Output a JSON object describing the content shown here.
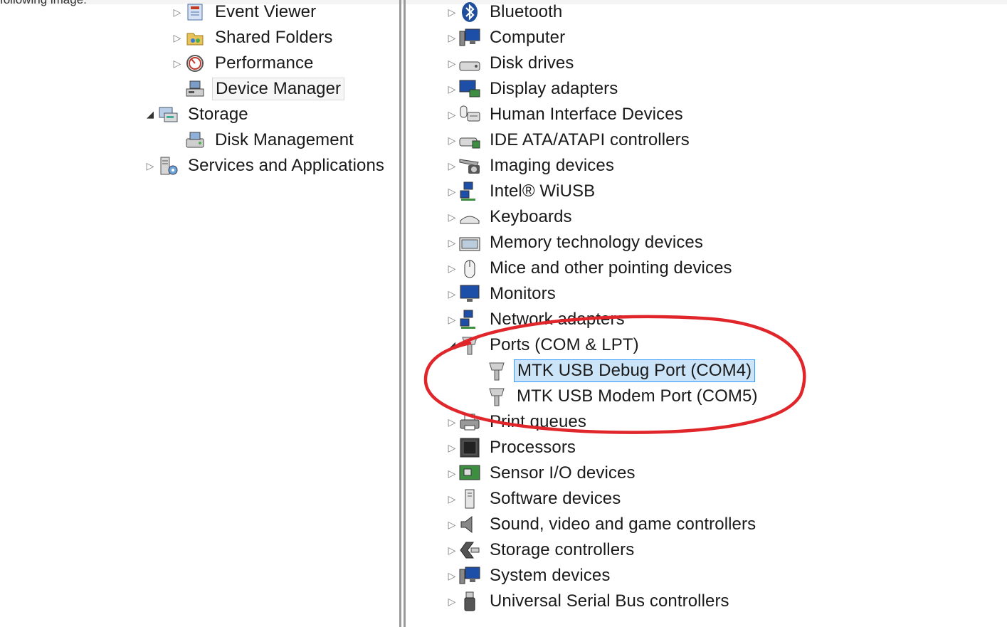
{
  "top_caption": "following image:",
  "left_tree": {
    "items": [
      {
        "label": "Event Viewer",
        "icon": "event-viewer-icon",
        "arrow": "▷"
      },
      {
        "label": "Shared Folders",
        "icon": "shared-folders-icon",
        "arrow": "▷"
      },
      {
        "label": "Performance",
        "icon": "performance-icon",
        "arrow": "▷"
      },
      {
        "label": "Device Manager",
        "icon": "device-manager-icon",
        "arrow": "",
        "selected": true
      },
      {
        "label": "Storage",
        "icon": "storage-icon",
        "arrow": "◢"
      },
      {
        "label": "Disk Management",
        "icon": "disk-management-icon",
        "arrow": ""
      },
      {
        "label": "Services and Applications",
        "icon": "services-icon",
        "arrow": "▷"
      }
    ]
  },
  "device_tree": {
    "categories": [
      {
        "label": "Bluetooth",
        "icon": "bluetooth-icon",
        "arrow": "▷"
      },
      {
        "label": "Computer",
        "icon": "computer-icon",
        "arrow": "▷"
      },
      {
        "label": "Disk drives",
        "icon": "disk-drive-icon",
        "arrow": "▷"
      },
      {
        "label": "Display adapters",
        "icon": "display-adapter-icon",
        "arrow": "▷"
      },
      {
        "label": "Human Interface Devices",
        "icon": "hid-icon",
        "arrow": "▷"
      },
      {
        "label": "IDE ATA/ATAPI controllers",
        "icon": "ide-controller-icon",
        "arrow": "▷"
      },
      {
        "label": "Imaging devices",
        "icon": "imaging-device-icon",
        "arrow": "▷"
      },
      {
        "label": "Intel® WiUSB",
        "icon": "network-icon",
        "arrow": "▷"
      },
      {
        "label": "Keyboards",
        "icon": "keyboard-icon",
        "arrow": "▷"
      },
      {
        "label": "Memory technology devices",
        "icon": "memory-device-icon",
        "arrow": "▷"
      },
      {
        "label": "Mice and other pointing devices",
        "icon": "mouse-icon",
        "arrow": "▷"
      },
      {
        "label": "Monitors",
        "icon": "monitor-icon",
        "arrow": "▷"
      },
      {
        "label": "Network adapters",
        "icon": "network-icon",
        "arrow": "▷"
      },
      {
        "label": "Ports (COM & LPT)",
        "icon": "port-icon",
        "arrow": "◢"
      },
      {
        "label": "MTK USB Debug Port (COM4)",
        "icon": "port-icon",
        "arrow": "",
        "child": true,
        "selected": true
      },
      {
        "label": "MTK USB Modem Port (COM5)",
        "icon": "port-icon",
        "arrow": "",
        "child": true
      },
      {
        "label": "Print queues",
        "icon": "printer-icon",
        "arrow": "▷"
      },
      {
        "label": "Processors",
        "icon": "processor-icon",
        "arrow": "▷"
      },
      {
        "label": "Sensor I/O devices",
        "icon": "sensor-icon",
        "arrow": "▷"
      },
      {
        "label": "Software devices",
        "icon": "software-device-icon",
        "arrow": "▷"
      },
      {
        "label": "Sound, video and game controllers",
        "icon": "sound-icon",
        "arrow": "▷"
      },
      {
        "label": "Storage controllers",
        "icon": "storage-controller-icon",
        "arrow": "▷"
      },
      {
        "label": "System devices",
        "icon": "system-devices-icon",
        "arrow": "▷"
      },
      {
        "label": "Universal Serial Bus controllers",
        "icon": "usb-icon",
        "arrow": "▷"
      }
    ]
  },
  "colors": {
    "annotation_ellipse": "#e0262b",
    "selection_blue_border": "#3399ff",
    "selection_blue_fill": "#cce4f7"
  }
}
